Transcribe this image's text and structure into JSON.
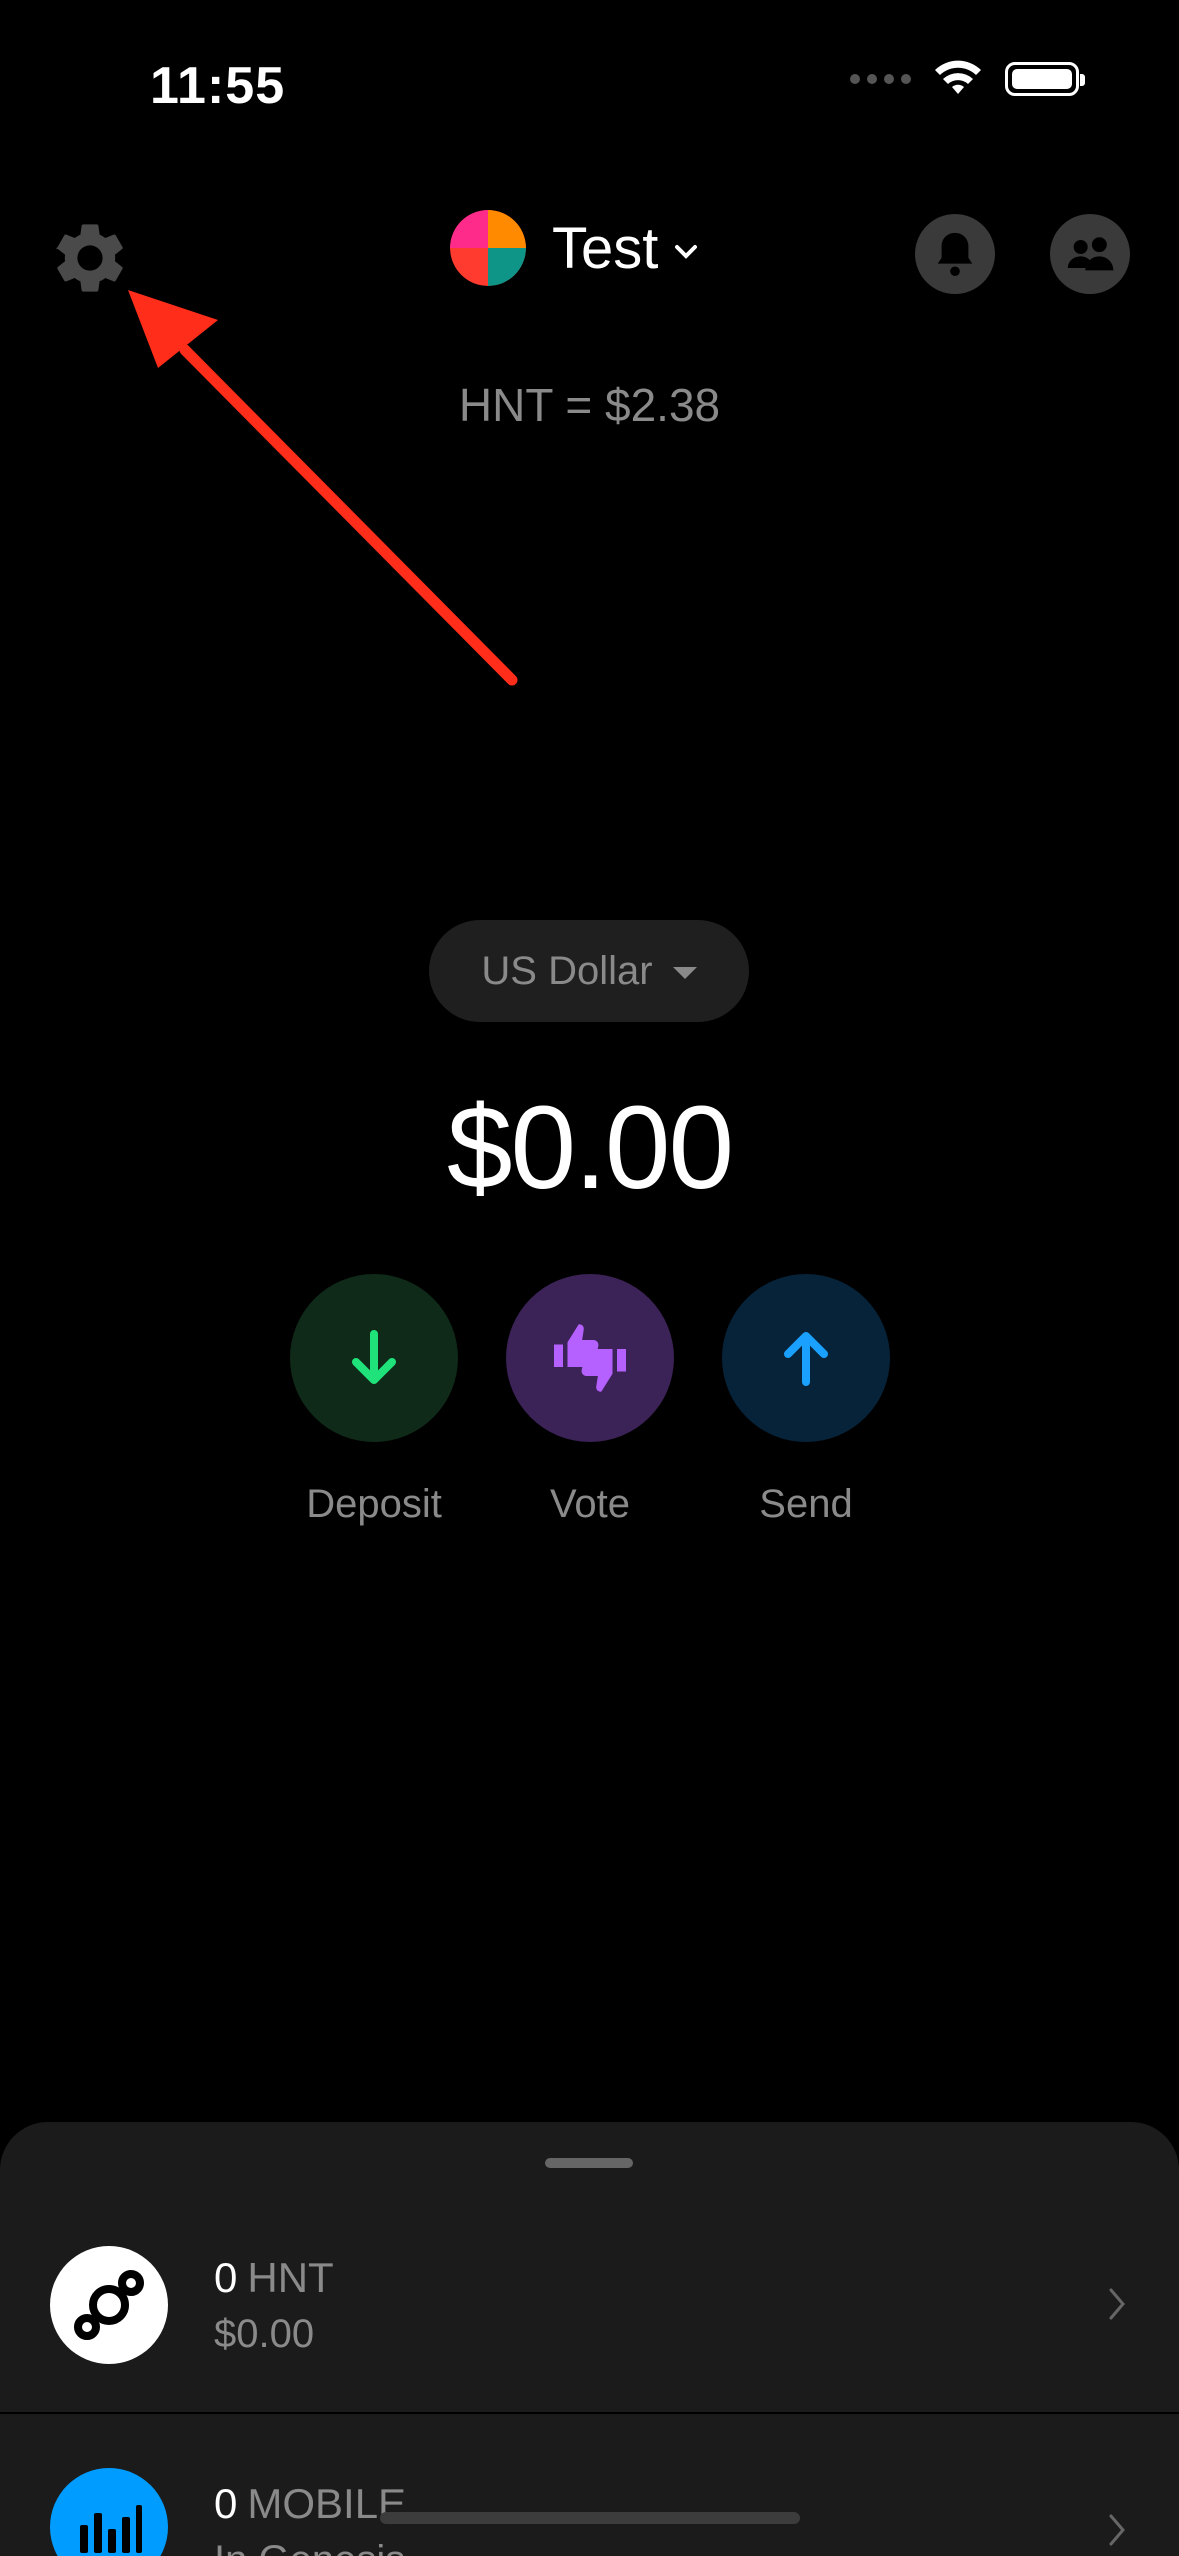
{
  "status_bar": {
    "time": "11:55",
    "battery_level": 1.0
  },
  "header": {
    "account_name": "Test",
    "price_text": "HNT = $2.38"
  },
  "wallet": {
    "currency_label": "US Dollar",
    "balance": "$0.00"
  },
  "actions": [
    {
      "label": "Deposit",
      "color": "#1fe27a",
      "bg": "#0f2a18"
    },
    {
      "label": "Vote",
      "color": "#b561ff",
      "bg": "#3b2257"
    },
    {
      "label": "Send",
      "color": "#1aa0ff",
      "bg": "#06233a"
    }
  ],
  "tokens": [
    {
      "amount": "0",
      "symbol": "HNT",
      "sub": "$0.00",
      "icon": "helium-icon",
      "icon_bg": "#ffffff"
    },
    {
      "amount": "0",
      "symbol": "MOBILE",
      "sub": "In Genesis",
      "icon": "mobile-icon",
      "icon_bg": "#009cff"
    }
  ],
  "colors": {
    "annotation_arrow": "#ff2d1a"
  }
}
